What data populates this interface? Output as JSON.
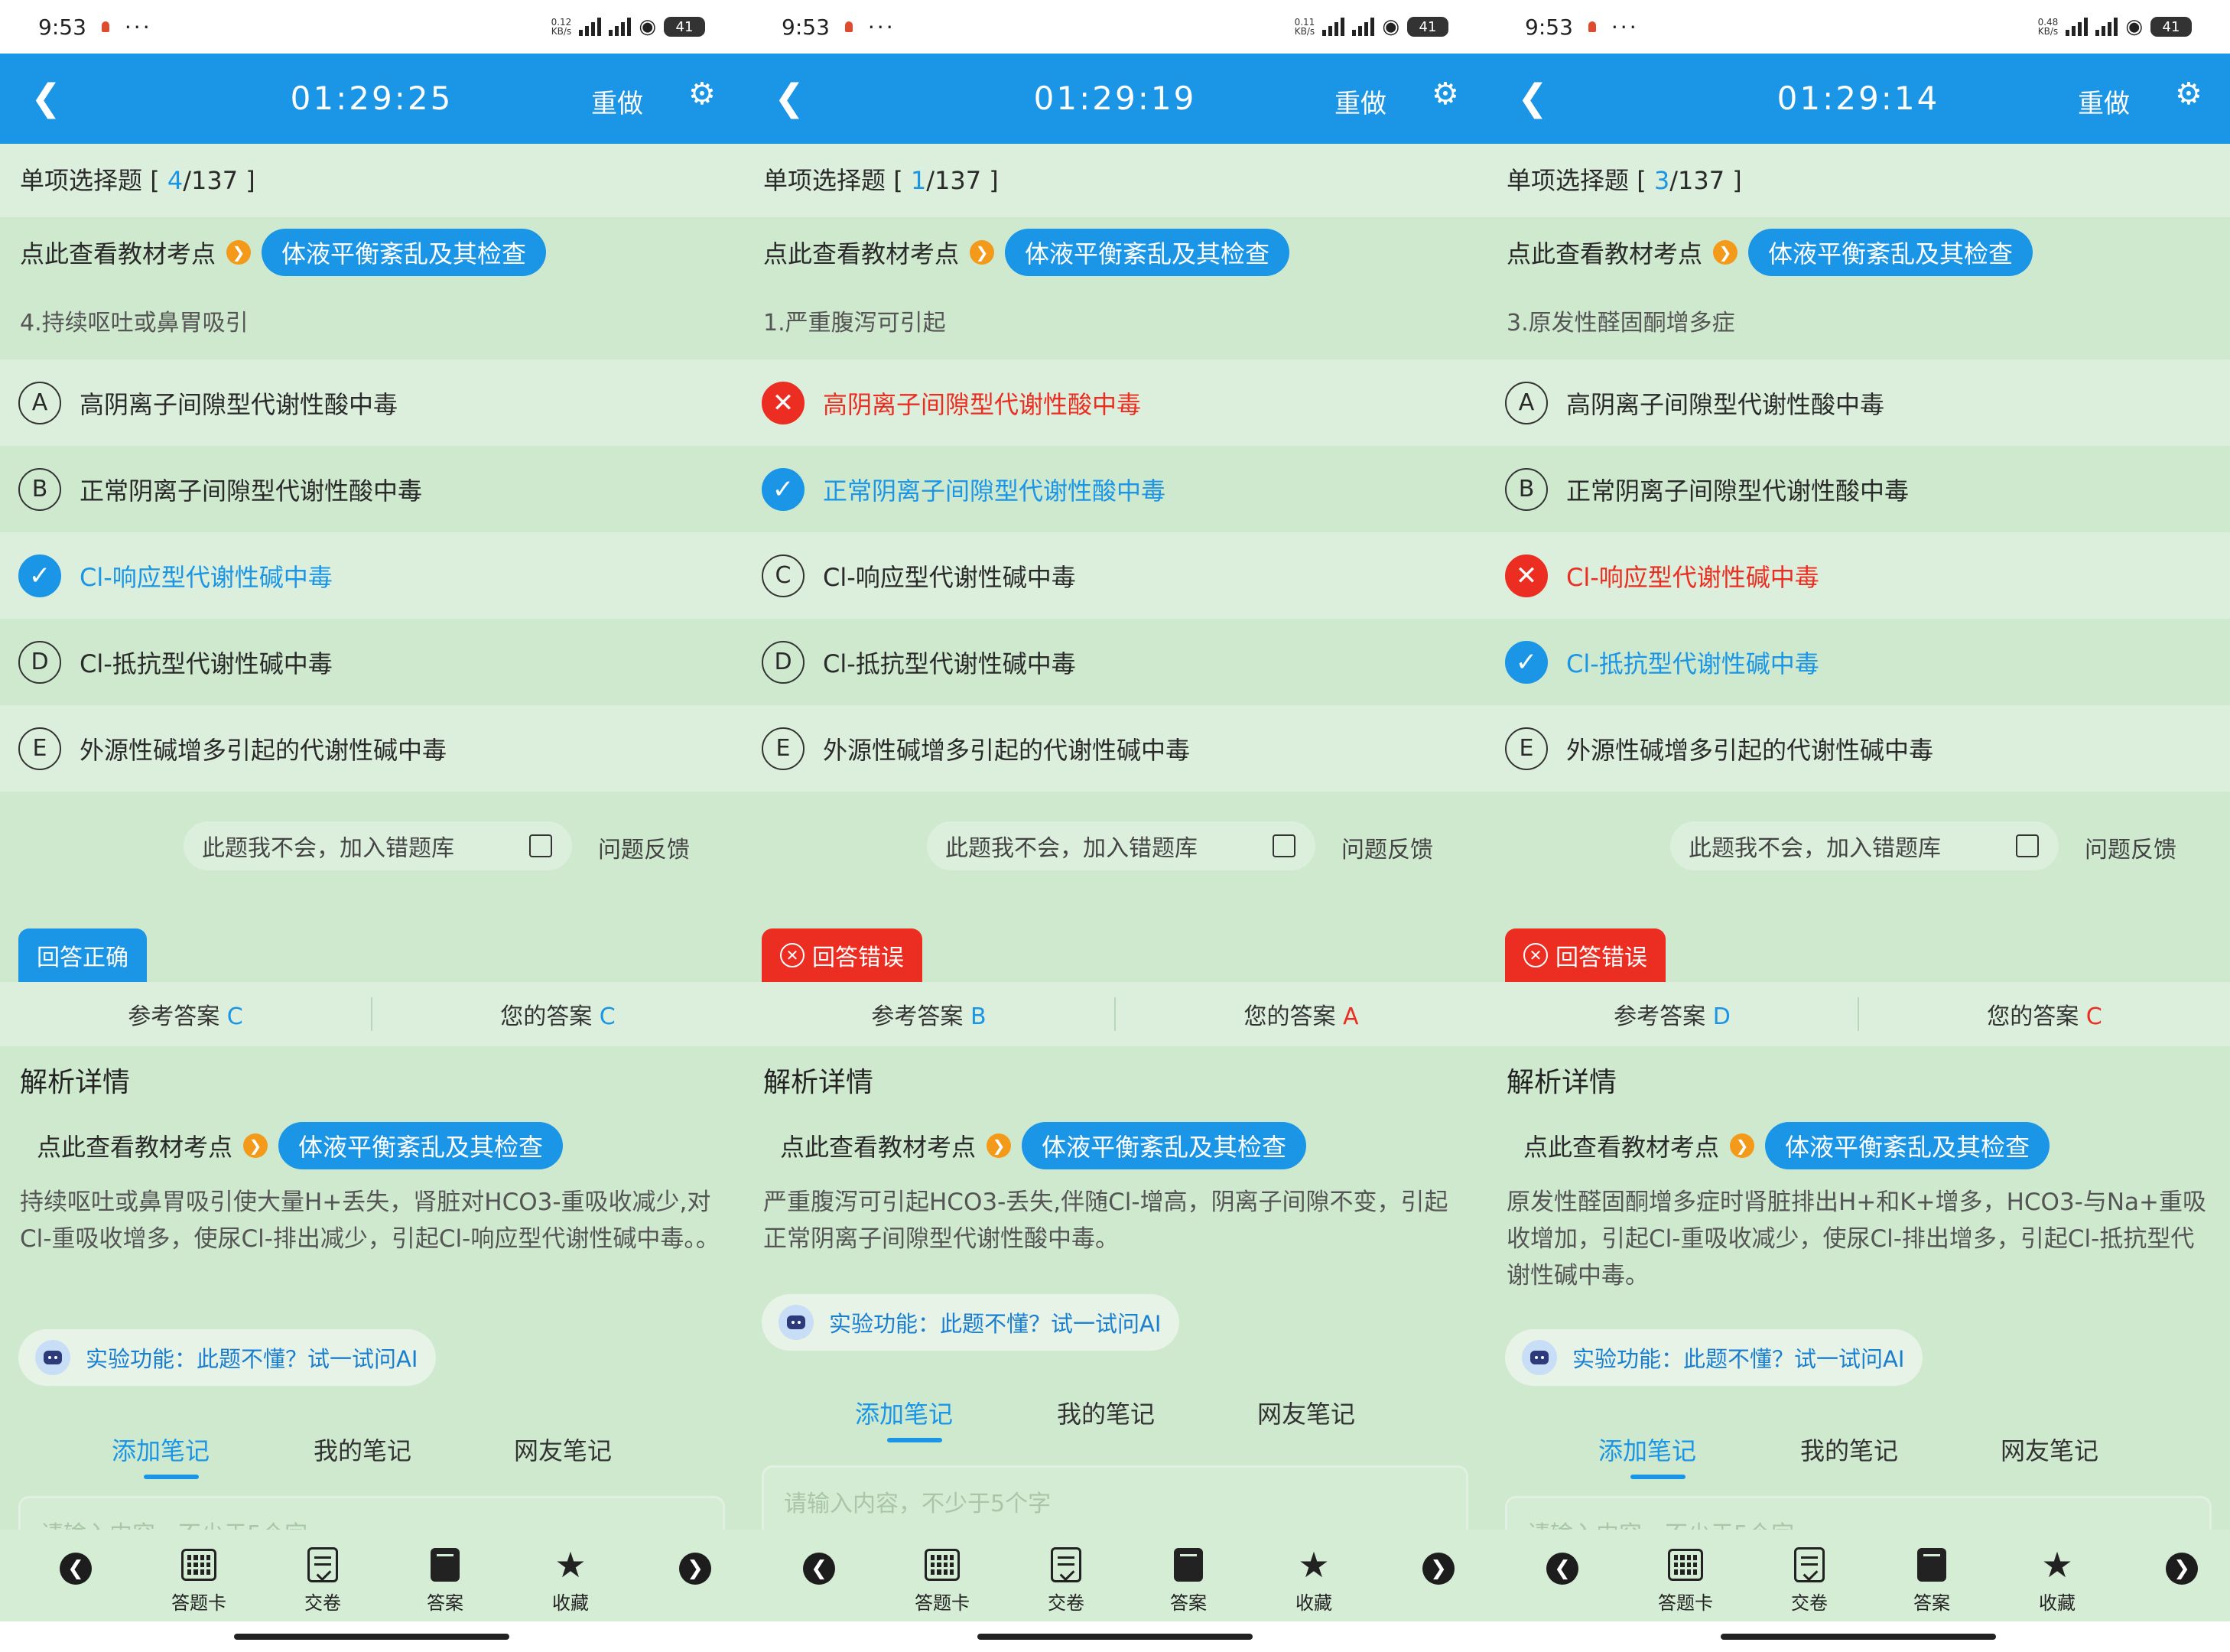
{
  "screens": [
    {
      "status": {
        "time": "9:53",
        "more": "···",
        "net_speed": "0.12\nKB/s",
        "battery": "41"
      },
      "timer": "01:29:25",
      "redo_label": "重做",
      "question_type": {
        "label": "单项选择题",
        "open": " [ ",
        "current": "4",
        "total": "/137 ]"
      },
      "knowledge_point": {
        "label": "点此查看教材考点",
        "topic": "体液平衡紊乱及其检查"
      },
      "question_text": "4.持续呕吐或鼻胃吸引",
      "options": [
        {
          "letter": "A",
          "text": "高阴离子间隙型代谢性酸中毒",
          "state": "normal"
        },
        {
          "letter": "B",
          "text": "正常阴离子间隙型代谢性酸中毒",
          "state": "normal"
        },
        {
          "letter": "C",
          "text": "Cl-响应型代谢性碱中毒",
          "state": "correct"
        },
        {
          "letter": "D",
          "text": "Cl-抵抗型代谢性碱中毒",
          "state": "normal"
        },
        {
          "letter": "E",
          "text": "外源性碱增多引起的代谢性碱中毒",
          "state": "normal"
        }
      ],
      "add_wrong_label": "此题我不会，加入错题库",
      "feedback_label": "问题反馈",
      "result": {
        "label": "回答正确",
        "status": "ok"
      },
      "reference_answer": {
        "label": "参考答案",
        "value": "C"
      },
      "your_answer": {
        "label": "您的答案",
        "value": "C",
        "correct": true
      },
      "analysis_title": "解析详情",
      "explanation": "持续呕吐或鼻胃吸引使大量H+丢失，肾脏对HCO3-重吸收减少,对Cl-重吸收增多，使尿Cl-排出减少，引起Cl-响应型代谢性碱中毒。。",
      "ai_label": "实验功能：此题不懂？试一试问AI",
      "note_tabs": [
        "添加笔记",
        "我的笔记",
        "网友笔记"
      ],
      "note_placeholder": "请输入内容，不少于5个字"
    },
    {
      "status": {
        "time": "9:53",
        "more": "···",
        "net_speed": "0.11\nKB/s",
        "battery": "41"
      },
      "timer": "01:29:19",
      "redo_label": "重做",
      "question_type": {
        "label": "单项选择题",
        "open": " [ ",
        "current": "1",
        "total": "/137 ]"
      },
      "knowledge_point": {
        "label": "点此查看教材考点",
        "topic": "体液平衡紊乱及其检查"
      },
      "question_text": "1.严重腹泻可引起",
      "options": [
        {
          "letter": "A",
          "text": "高阴离子间隙型代谢性酸中毒",
          "state": "wrong"
        },
        {
          "letter": "B",
          "text": "正常阴离子间隙型代谢性酸中毒",
          "state": "correct"
        },
        {
          "letter": "C",
          "text": "Cl-响应型代谢性碱中毒",
          "state": "normal"
        },
        {
          "letter": "D",
          "text": "Cl-抵抗型代谢性碱中毒",
          "state": "normal"
        },
        {
          "letter": "E",
          "text": "外源性碱增多引起的代谢性碱中毒",
          "state": "normal"
        }
      ],
      "add_wrong_label": "此题我不会，加入错题库",
      "feedback_label": "问题反馈",
      "result": {
        "label": "回答错误",
        "status": "bad"
      },
      "reference_answer": {
        "label": "参考答案",
        "value": "B"
      },
      "your_answer": {
        "label": "您的答案",
        "value": "A",
        "correct": false
      },
      "analysis_title": "解析详情",
      "explanation": "严重腹泻可引起HCO3-丢失,伴随Cl-增高，阴离子间隙不变，引起正常阴离子间隙型代谢性酸中毒。",
      "ai_label": "实验功能：此题不懂？试一试问AI",
      "note_tabs": [
        "添加笔记",
        "我的笔记",
        "网友笔记"
      ],
      "note_placeholder": "请输入内容，不少于5个字"
    },
    {
      "status": {
        "time": "9:53",
        "more": "···",
        "net_speed": "0.48\nKB/s",
        "battery": "41"
      },
      "timer": "01:29:14",
      "redo_label": "重做",
      "question_type": {
        "label": "单项选择题",
        "open": " [ ",
        "current": "3",
        "total": "/137 ]"
      },
      "knowledge_point": {
        "label": "点此查看教材考点",
        "topic": "体液平衡紊乱及其检查"
      },
      "question_text": "3.原发性醛固酮增多症",
      "options": [
        {
          "letter": "A",
          "text": "高阴离子间隙型代谢性酸中毒",
          "state": "normal"
        },
        {
          "letter": "B",
          "text": "正常阴离子间隙型代谢性酸中毒",
          "state": "normal"
        },
        {
          "letter": "C",
          "text": "Cl-响应型代谢性碱中毒",
          "state": "wrong"
        },
        {
          "letter": "D",
          "text": "Cl-抵抗型代谢性碱中毒",
          "state": "correct"
        },
        {
          "letter": "E",
          "text": "外源性碱增多引起的代谢性碱中毒",
          "state": "normal"
        }
      ],
      "add_wrong_label": "此题我不会，加入错题库",
      "feedback_label": "问题反馈",
      "result": {
        "label": "回答错误",
        "status": "bad"
      },
      "reference_answer": {
        "label": "参考答案",
        "value": "D"
      },
      "your_answer": {
        "label": "您的答案",
        "value": "C",
        "correct": false
      },
      "analysis_title": "解析详情",
      "explanation": "原发性醛固酮增多症时肾脏排出H+和K+增多，HCO3-与Na+重吸收增加，引起Cl-重吸收减少，使尿Cl-排出增多，引起Cl-抵抗型代谢性碱中毒。",
      "ai_label": "实验功能：此题不懂？试一试问AI",
      "note_tabs": [
        "添加笔记",
        "我的笔记",
        "网友笔记"
      ],
      "note_placeholder": "请输入内容，不少于5个字"
    }
  ],
  "bottom_bar": {
    "items": [
      "答题卡",
      "交卷",
      "答案",
      "收藏"
    ]
  },
  "icons": {
    "back": "chevron-left-icon",
    "settings": "gear-icon",
    "knowledge_arrow": "chevron-right-circle-icon",
    "correct": "check-circle-icon",
    "wrong": "close-circle-icon",
    "ai": "robot-icon",
    "answer_card": "grid-icon",
    "submit": "document-check-icon",
    "answer": "book-icon",
    "favorite": "star-icon"
  },
  "colors": {
    "accent": "#1b95e6",
    "error": "#ec2d22",
    "background": "#cfe9cf",
    "row_alt": "#dcefdc",
    "knowledge_arrow": "#f49a1a"
  }
}
